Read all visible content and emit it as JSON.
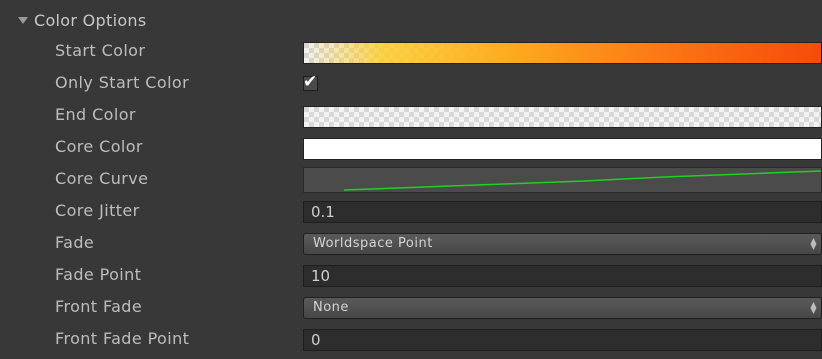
{
  "section": {
    "title": "Color Options"
  },
  "fields": {
    "start_color_label": "Start Color",
    "only_start_color_label": "Only Start Color",
    "only_start_color_checked": true,
    "end_color_label": "End Color",
    "core_color_label": "Core Color",
    "core_curve_label": "Core Curve",
    "core_jitter_label": "Core Jitter",
    "core_jitter_value": "0.1",
    "fade_label": "Fade",
    "fade_value": "Worldspace Point",
    "fade_point_label": "Fade Point",
    "fade_point_value": "10",
    "front_fade_label": "Front Fade",
    "front_fade_value": "None",
    "front_fade_point_label": "Front Fade Point",
    "front_fade_point_value": "0"
  },
  "colors": {
    "background": "#383838",
    "start_gradient_end": "#f54b0a",
    "core_color": "#ffffff",
    "curve_line": "#1ed21e"
  },
  "icons": {
    "foldout": "triangle-down",
    "checkmark": "check",
    "dropdown_arrow": "up-down-chevrons"
  }
}
